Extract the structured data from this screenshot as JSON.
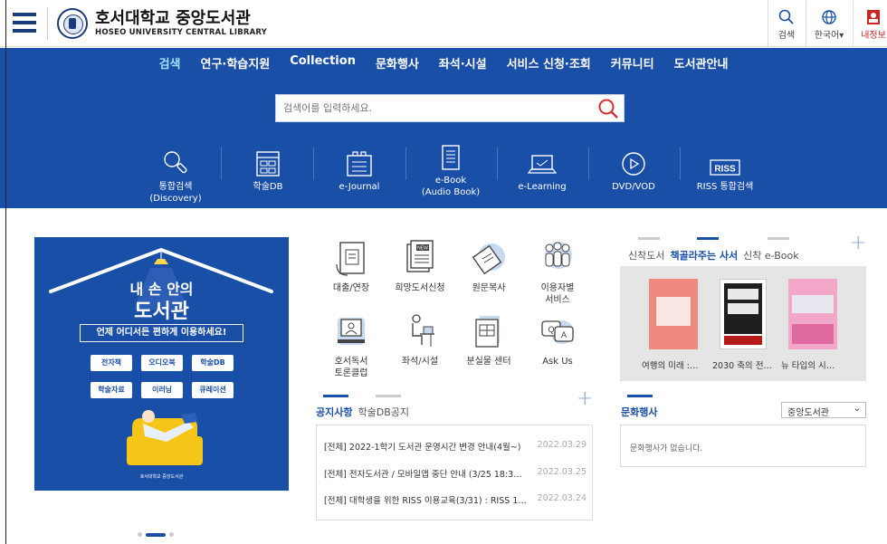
{
  "header": {
    "title_ko": "호서대학교 중앙도서관",
    "title_en": "HOSEO UNIVERSITY CENTRAL LIBRARY",
    "utils": [
      {
        "label": "검색",
        "icon": "search-icon"
      },
      {
        "label": "한국어▾",
        "icon": "globe-icon"
      },
      {
        "label": "내정보",
        "icon": "user-icon"
      }
    ]
  },
  "gnb": [
    "검색",
    "연구·학습지원",
    "Collection",
    "문화행사",
    "좌석·시설",
    "서비스 신청·조회",
    "커뮤니티",
    "도서관안내"
  ],
  "search": {
    "placeholder": "검색어를 입력하세요."
  },
  "quick": [
    {
      "line1": "통합검색",
      "line2": "(Discovery)",
      "icon": "magnifier-icon"
    },
    {
      "line1": "학술DB",
      "line2": "",
      "icon": "database-icon"
    },
    {
      "line1": "e-Journal",
      "line2": "",
      "icon": "journal-icon"
    },
    {
      "line1": "e-Book",
      "line2": "(Audio Book)",
      "icon": "ebook-icon"
    },
    {
      "line1": "e-Learning",
      "line2": "",
      "icon": "laptop-icon"
    },
    {
      "line1": "DVD/VOD",
      "line2": "",
      "icon": "play-icon"
    },
    {
      "line1": "RISS 통합검색",
      "line2": "",
      "icon": "riss-icon"
    }
  ],
  "banner": {
    "line1": "내 손 안의",
    "line2": "도서관",
    "sub": "언제 어디서든 편하게 이용하세요!",
    "buttons": [
      "전자책",
      "오디오북",
      "학술DB",
      "학술자료",
      "이러닝",
      "큐레이션"
    ],
    "footer": "호서대학교 중앙도서관"
  },
  "services": [
    {
      "line1": "대출/연장",
      "line2": "",
      "icon": "loan-icon"
    },
    {
      "line1": "희망도서신청",
      "line2": "",
      "icon": "new-book-icon"
    },
    {
      "line1": "원문복사",
      "line2": "",
      "icon": "copy-icon"
    },
    {
      "line1": "이용자별",
      "line2": "서비스",
      "icon": "users-icon"
    },
    {
      "line1": "호서독서",
      "line2": "토론클럽",
      "icon": "discussion-icon"
    },
    {
      "line1": "좌석/시설",
      "line2": "",
      "icon": "seat-icon"
    },
    {
      "line1": "분실물 센터",
      "line2": "",
      "icon": "lost-found-icon"
    },
    {
      "line1": "Ask Us",
      "line2": "",
      "icon": "chat-icon"
    }
  ],
  "notice": {
    "tabs": [
      "공지사항",
      "학술DB공지"
    ],
    "items": [
      {
        "title": "[전체] 2022-1학기 도서관 운영시간 변경 안내(4월~)",
        "date": "2022.03.29"
      },
      {
        "title": "[전체] 전자도서관 / 모바일앱 중단 안내 (3/25 18:3…",
        "date": "2022.03.25"
      },
      {
        "title": "[전체] 대학생을 위한 RISS 이용교육(3/31) : RISS 1…",
        "date": "2022.03.24"
      }
    ]
  },
  "books": {
    "tabs": [
      "신착도서",
      "책골라주는 사서",
      "신착 e-Book"
    ],
    "items": [
      "여행의 미래 :…",
      "2030 축의 전…",
      "뉴 타입의 시…"
    ]
  },
  "events": {
    "tab": "문화행사",
    "select": "중앙도서관",
    "empty": "문화행사가 없습니다."
  },
  "colors": {
    "brand": "#1a4fa8",
    "accent": "#9fe0ff"
  }
}
